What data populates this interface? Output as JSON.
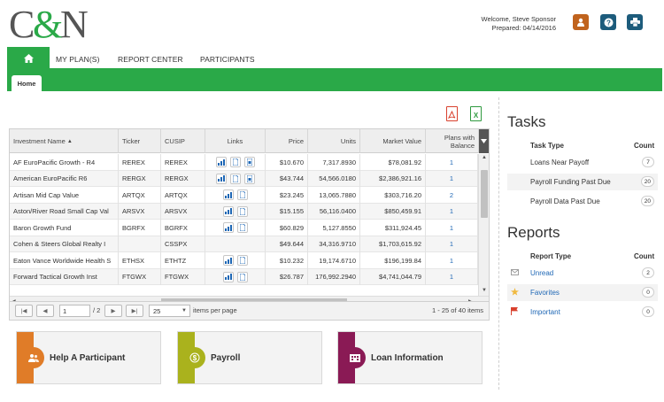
{
  "header": {
    "logo_text": "C&N",
    "welcome": "Welcome, Steve Sponsor",
    "prepared": "Prepared: 04/14/2016"
  },
  "nav": {
    "items": [
      "MY PLAN(S)",
      "REPORT CENTER",
      "PARTICIPANTS"
    ],
    "subtab": "Home"
  },
  "grid": {
    "columns": [
      "Investment Name",
      "Ticker",
      "CUSIP",
      "Links",
      "Price",
      "Units",
      "Market Value",
      "Plans with Balance"
    ],
    "rows": [
      {
        "name": "AF EuroPacific Growth - R4",
        "ticker": "REREX",
        "cusip": "REREX",
        "price": "$10.670",
        "units": "7,317.8930",
        "value": "$78,081.92",
        "plans": "1"
      },
      {
        "name": "American EuroPacific R6",
        "ticker": "RERGX",
        "cusip": "RERGX",
        "price": "$43.744",
        "units": "54,566.0180",
        "value": "$2,386,921.16",
        "plans": "1"
      },
      {
        "name": "Artisan Mid Cap Value",
        "ticker": "ARTQX",
        "cusip": "ARTQX",
        "price": "$23.245",
        "units": "13,065.7880",
        "value": "$303,716.20",
        "plans": "2"
      },
      {
        "name": "Aston/River Road Small Cap Val",
        "ticker": "ARSVX",
        "cusip": "ARSVX",
        "price": "$15.155",
        "units": "56,116.0400",
        "value": "$850,459.91",
        "plans": "1"
      },
      {
        "name": "Baron Growth Fund",
        "ticker": "BGRFX",
        "cusip": "BGRFX",
        "price": "$60.829",
        "units": "5,127.8550",
        "value": "$311,924.45",
        "plans": "1"
      },
      {
        "name": "Cohen & Steers Global Realty I",
        "ticker": "",
        "cusip": "CSSPX",
        "price": "$49.644",
        "units": "34,316.9710",
        "value": "$1,703,615.92",
        "plans": "1"
      },
      {
        "name": "Eaton Vance Worldwide Health S",
        "ticker": "ETHSX",
        "cusip": "ETHTZ",
        "price": "$10.232",
        "units": "19,174.6710",
        "value": "$196,199.84",
        "plans": "1"
      },
      {
        "name": "Forward Tactical Growth Inst",
        "ticker": "FTGWX",
        "cusip": "FTGWX",
        "price": "$26.787",
        "units": "176,992.2940",
        "value": "$4,741,044.79",
        "plans": "1"
      }
    ],
    "row_links": [
      3,
      3,
      2,
      2,
      2,
      0,
      2,
      2
    ]
  },
  "pager": {
    "page": "1",
    "of_pages": "/ 2",
    "per_page": "25",
    "per_page_label": "items per page",
    "summary": "1 - 25 of 40 items"
  },
  "tiles": [
    {
      "label": "Help A Participant",
      "color": "#e07c28"
    },
    {
      "label": "Payroll",
      "color": "#aab21d"
    },
    {
      "label": "Loan Information",
      "color": "#8a1a55"
    }
  ],
  "tasks": {
    "title": "Tasks",
    "col_type": "Task Type",
    "col_count": "Count",
    "items": [
      {
        "label": "Loans Near Payoff",
        "count": "7"
      },
      {
        "label": "Payroll Funding Past Due",
        "count": "20"
      },
      {
        "label": "Payroll Data Past Due",
        "count": "20"
      }
    ]
  },
  "reports": {
    "title": "Reports",
    "col_type": "Report Type",
    "col_count": "Count",
    "items": [
      {
        "label": "Unread",
        "count": "2",
        "icon": "envelope-icon"
      },
      {
        "label": "Favorites",
        "count": "0",
        "icon": "star-icon"
      },
      {
        "label": "Important",
        "count": "0",
        "icon": "flag-icon"
      }
    ]
  },
  "colors": {
    "brand_green": "#2aa948",
    "link_blue": "#1e67b5",
    "header_blue": "#1d5c7c",
    "user_orange": "#c0631d"
  }
}
